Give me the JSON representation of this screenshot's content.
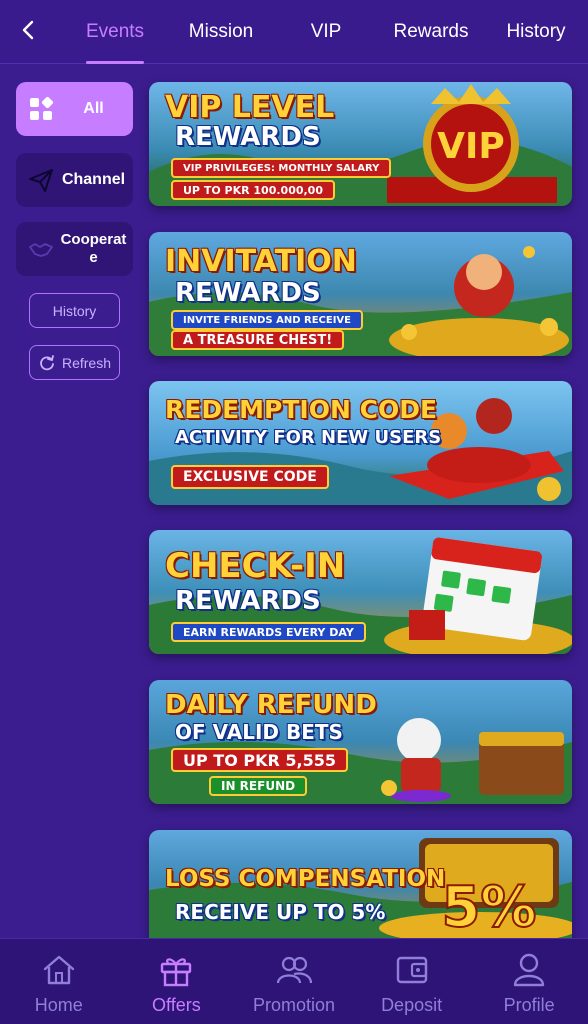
{
  "header": {
    "tabs": [
      {
        "label": "Events",
        "active": true
      },
      {
        "label": "Mission",
        "active": false
      },
      {
        "label": "VIP",
        "active": false
      },
      {
        "label": "Rewards",
        "active": false
      },
      {
        "label": "History",
        "active": false
      }
    ]
  },
  "sidebar": {
    "categories": [
      {
        "label": "All",
        "icon": "grid-icon",
        "active": true
      },
      {
        "label": "Channel",
        "icon": "paper-plane-icon",
        "active": false
      },
      {
        "label": "Cooperat e",
        "icon": "handshake-icon",
        "active": false
      }
    ],
    "history_label": "History",
    "refresh_label": "Refresh"
  },
  "banners": [
    {
      "title": "VIP LEVEL",
      "sub": "REWARDS",
      "line1": "VIP PRIVILEGES: MONTHLY SALARY",
      "line2": "UP TO PKR 100.000,00",
      "badge": "VIP"
    },
    {
      "title": "INVITATION",
      "sub": "REWARDS",
      "line1": "INVITE FRIENDS AND RECEIVE",
      "line2": "A TREASURE CHEST!"
    },
    {
      "title": "REDEMPTION CODE",
      "sub": "ACTIVITY FOR NEW USERS",
      "line2": "EXCLUSIVE CODE"
    },
    {
      "title": "CHECK-IN",
      "sub": "REWARDS",
      "line2": "EARN REWARDS EVERY DAY"
    },
    {
      "title": "DAILY REFUND",
      "sub": "OF VALID BETS",
      "line1": "UP TO PKR 5,555",
      "line2": "IN REFUND"
    },
    {
      "title": "LOSS COMPENSATION",
      "sub": "RECEIVE UP TO 5%",
      "badge": "5%"
    }
  ],
  "bottom_nav": [
    {
      "label": "Home",
      "icon": "home-icon",
      "active": false
    },
    {
      "label": "Offers",
      "icon": "gift-icon",
      "active": true
    },
    {
      "label": "Promotion",
      "icon": "people-icon",
      "active": false
    },
    {
      "label": "Deposit",
      "icon": "wallet-icon",
      "active": false
    },
    {
      "label": "Profile",
      "icon": "person-icon",
      "active": false
    }
  ],
  "colors": {
    "background": "#3b1d8f",
    "accent": "#c77dff",
    "nav_inactive": "#8f7fd8",
    "sidebar_button": "#301577"
  }
}
